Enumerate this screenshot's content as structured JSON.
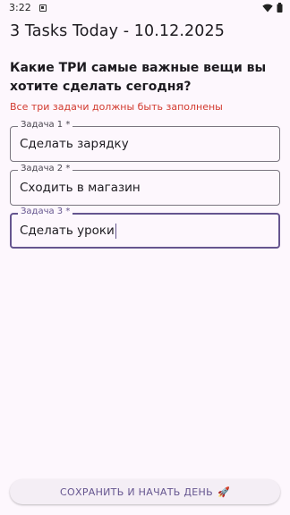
{
  "status_bar": {
    "time": "3:22",
    "notification_icon": "notification-icon",
    "wifi_icon": "wifi-icon",
    "battery_icon": "battery-icon"
  },
  "app_bar": {
    "title": "3 Tasks Today - 10.12.2025"
  },
  "prompt": {
    "question": "Какие ТРИ самые важные вещи вы хотите сделать сегодня?",
    "error": "Все три задачи должны быть заполнены"
  },
  "tasks": [
    {
      "label": "Задача 1 *",
      "value": "Сделать зарядку"
    },
    {
      "label": "Задача 2 *",
      "value": "Сходить в магазин"
    },
    {
      "label": "Задача 3 *",
      "value": "Сделать уроки"
    }
  ],
  "actions": {
    "save_label": "СОХРАНИТЬ И НАЧАТЬ ДЕНЬ",
    "save_icon": "🚀"
  },
  "colors": {
    "background": "#fdf7fd",
    "accent": "#65558f",
    "error": "#d23a2f"
  }
}
